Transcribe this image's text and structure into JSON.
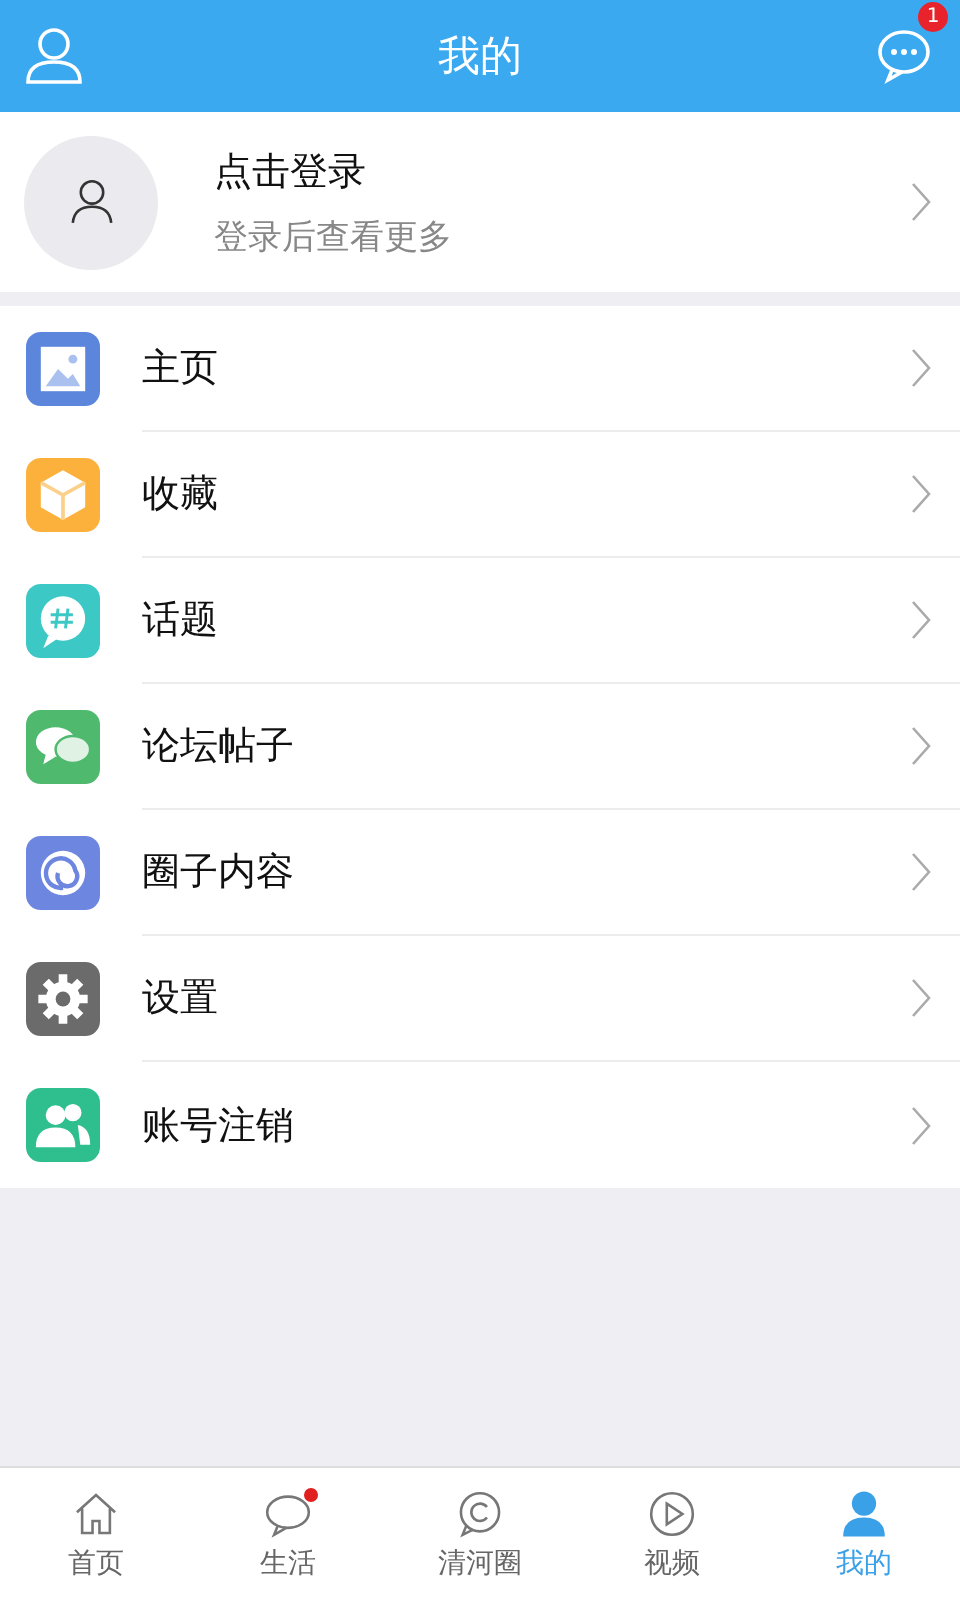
{
  "header": {
    "title": "我的",
    "message_badge": "1"
  },
  "profile": {
    "name": "点击登录",
    "hint": "登录后查看更多"
  },
  "menu": [
    {
      "label": "主页",
      "kind": "image",
      "color": "#5b86dc"
    },
    {
      "label": "收藏",
      "kind": "box",
      "color": "#fbb13c"
    },
    {
      "label": "话题",
      "kind": "topic",
      "color": "#3cc8c4"
    },
    {
      "label": "论坛帖子",
      "kind": "chat",
      "color": "#4fb96e"
    },
    {
      "label": "圈子内容",
      "kind": "circle",
      "color": "#6d87e0"
    },
    {
      "label": "设置",
      "kind": "gear",
      "color": "#6b6b6b"
    },
    {
      "label": "账号注销",
      "kind": "users",
      "color": "#2fbf8f"
    }
  ],
  "tabbar": [
    {
      "label": "首页",
      "kind": "home",
      "selected": false,
      "dot": false
    },
    {
      "label": "生活",
      "kind": "bubble",
      "selected": false,
      "dot": true
    },
    {
      "label": "清河圈",
      "kind": "ring",
      "selected": false,
      "dot": false
    },
    {
      "label": "视频",
      "kind": "play",
      "selected": false,
      "dot": false
    },
    {
      "label": "我的",
      "kind": "person",
      "selected": true,
      "dot": false
    }
  ]
}
